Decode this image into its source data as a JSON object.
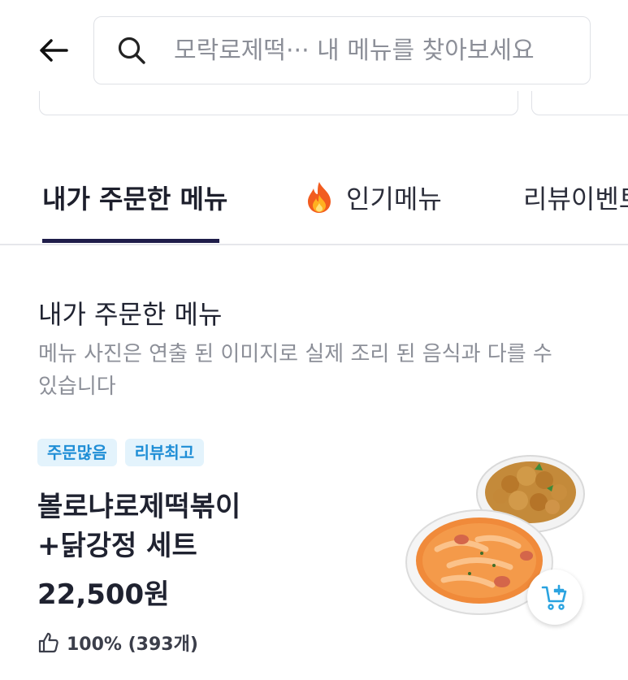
{
  "search": {
    "placeholder": "모락로제떡··· 내 메뉴를 찾아보세요"
  },
  "tabs": [
    {
      "label": "내가 주문한 메뉴",
      "active": true
    },
    {
      "label": "인기메뉴",
      "icon": "fire-icon",
      "active": false
    },
    {
      "label": "리뷰이벤트",
      "active": false
    }
  ],
  "section": {
    "title": "내가 주문한 메뉴",
    "description": "메뉴 사진은 연출 된 이미지로 실제 조리 된 음식과 다를 수 있습니다"
  },
  "item": {
    "badges": [
      "주문많음",
      "리뷰최고"
    ],
    "name_line1": "볼로냐로제떡볶이",
    "name_line2": "+닭강정 세트",
    "price": "22,500원",
    "rating": "100% (393개)"
  },
  "colors": {
    "accent_dark": "#1f1d4a",
    "badge_bg": "#e3f3fc",
    "badge_text": "#1f8ed6",
    "cart_icon": "#2aa3e0"
  }
}
